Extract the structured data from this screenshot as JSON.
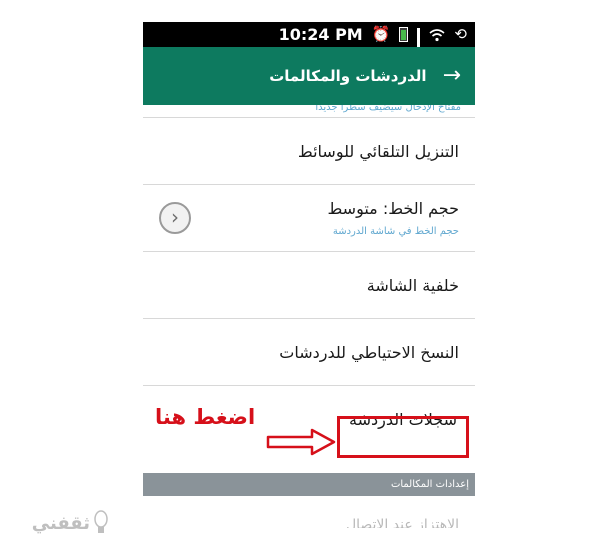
{
  "status_bar": {
    "time": "10:24 PM",
    "icons": [
      "sync-icon",
      "wifi-icon",
      "signal-icon",
      "battery-icon",
      "alarm-icon"
    ]
  },
  "header": {
    "title": "الدردشات والمكالمات",
    "back_icon": "arrow-right-icon",
    "color": "#0d7a5f"
  },
  "list": {
    "cut_subtitle": "مفتاح الإدخال سيضيف سطرا جديدا",
    "items": [
      {
        "title": "التنزيل التلقائي للوسائط"
      },
      {
        "title": "حجم الخط: متوسط",
        "subtitle": "حجم الخط في شاشة الدردشة",
        "icon": "chevron-icon"
      },
      {
        "title": "خلفية الشاشة"
      },
      {
        "title": "النسخ الاحتياطي للدردشات"
      },
      {
        "title": "سجلات الدردشة"
      }
    ],
    "section_header": "إعدادات المكالمات",
    "partial_item": "الاهتزاز عند الاتصال"
  },
  "annotation": {
    "text": "اضغط هنا",
    "color": "#d6101a"
  },
  "watermark": {
    "text": "ثقفني"
  }
}
